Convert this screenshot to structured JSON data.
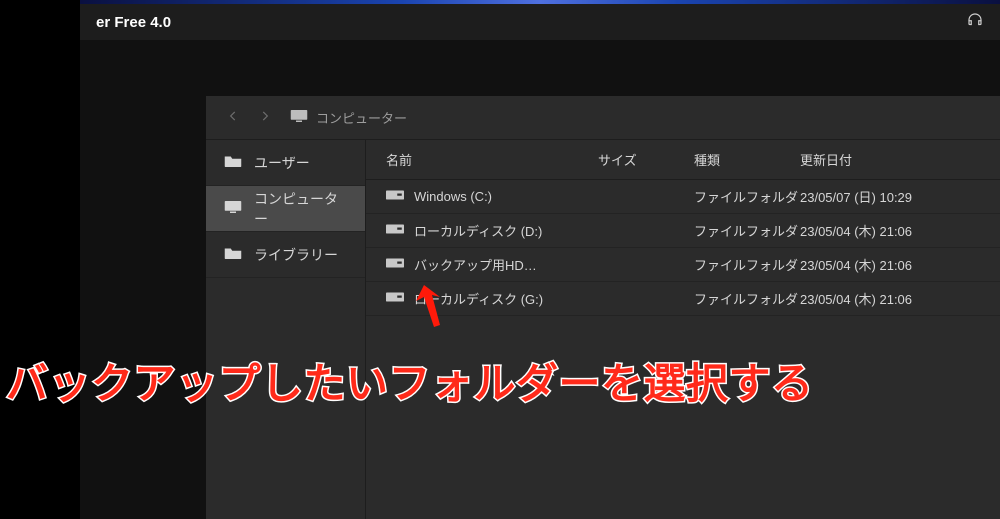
{
  "window": {
    "title_fragment": "er Free 4.0"
  },
  "breadcrumb": {
    "label": "コンピューター"
  },
  "sidebar": {
    "items": [
      {
        "id": "users",
        "label": "ユーザー",
        "icon": "users-folder-icon",
        "selected": false
      },
      {
        "id": "computer",
        "label": "コンピューター",
        "icon": "monitor-icon",
        "selected": true
      },
      {
        "id": "library",
        "label": "ライブラリー",
        "icon": "folder-icon",
        "selected": false
      }
    ]
  },
  "table": {
    "headers": {
      "name": "名前",
      "size": "サイズ",
      "type": "種類",
      "date": "更新日付"
    },
    "rows": [
      {
        "name": "Windows (C:)",
        "size": "",
        "type": "ファイルフォルダ",
        "date": "23/05/07 (日) 10:29"
      },
      {
        "name": "ローカルディスク (D:)",
        "size": "",
        "type": "ファイルフォルダ",
        "date": "23/05/04 (木) 21:06"
      },
      {
        "name": "バックアップ用HD…",
        "size": "",
        "type": "ファイルフォルダ",
        "date": "23/05/04 (木) 21:06"
      },
      {
        "name": "ローカルディスク (G:)",
        "size": "",
        "type": "ファイルフォルダ",
        "date": "23/05/04 (木) 21:06"
      }
    ]
  },
  "annotation": {
    "text": "バックアップしたいフォルダーを選択する"
  }
}
